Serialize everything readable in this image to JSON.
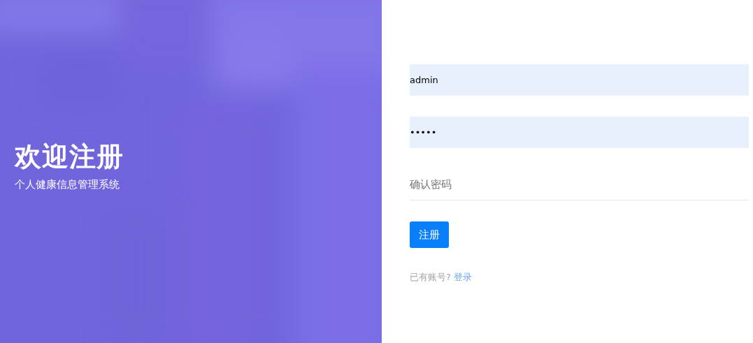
{
  "hero": {
    "title": "欢迎注册",
    "subtitle": "个人健康信息管理系统",
    "kind": "picture"
  },
  "form": {
    "fields": [
      {
        "value": "admin",
        "autofilled": true
      },
      {
        "value": "•••••",
        "autofilled": true
      },
      {
        "placeholder": "确认密码",
        "autofilled": false
      }
    ],
    "submit": "注册",
    "footer": {
      "text": "已有账号?",
      "link": "登录"
    }
  }
}
